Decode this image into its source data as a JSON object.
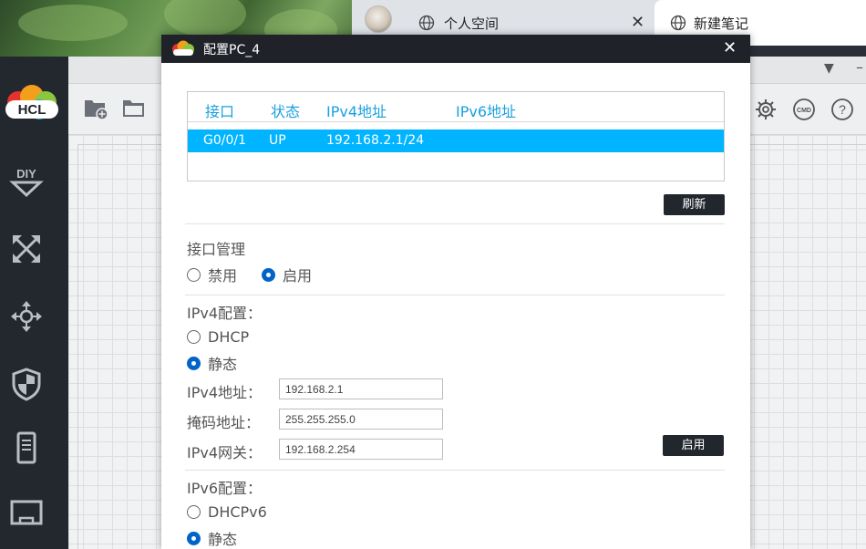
{
  "browser": {
    "tabs": [
      {
        "title": "个人空间"
      },
      {
        "title": "新建笔记"
      }
    ],
    "close_glyph": "✕"
  },
  "app": {
    "logo_text": "HCL",
    "sidebar_icons": [
      "diy-icon",
      "topology-icon",
      "move-icon",
      "shield-icon",
      "server-icon",
      "terminal-icon"
    ],
    "header_controls": [
      "▼",
      "–"
    ],
    "toolbar_icons": [
      "new-folder-icon",
      "folder-icon",
      "gear-icon",
      "cmd-icon",
      "help-icon"
    ],
    "cmd_label": "CMD",
    "help_label": "?"
  },
  "dialog": {
    "title": "配置PC_4",
    "close_glyph": "✕",
    "table": {
      "headers": [
        "接口",
        "状态",
        "IPv4地址",
        "IPv6地址"
      ],
      "rows": [
        {
          "interface": "G0/0/1",
          "status": "UP",
          "ipv4": "192.168.2.1/24",
          "ipv6": ""
        }
      ]
    },
    "refresh_button": "刷新",
    "iface_mgmt": {
      "label": "接口管理",
      "options": [
        "禁用",
        "启用"
      ],
      "selected": "启用"
    },
    "ipv4": {
      "label": "IPv4配置：",
      "options": [
        "DHCP",
        "静态"
      ],
      "selected": "静态",
      "address_label": "IPv4地址：",
      "address": "192.168.2.1",
      "mask_label": "掩码地址：",
      "mask": "255.255.255.0",
      "gateway_label": "IPv4网关：",
      "gateway": "192.168.2.254",
      "apply_button": "启用"
    },
    "ipv6": {
      "label": "IPv6配置：",
      "options": [
        "DHCPv6",
        "静态"
      ],
      "selected": "静态"
    }
  },
  "colors": {
    "accent": "#00b4ff",
    "header_text": "#1aa0e0",
    "radio_selected": "#0064c8",
    "titlebar": "#1f2329",
    "button": "#22272e"
  }
}
